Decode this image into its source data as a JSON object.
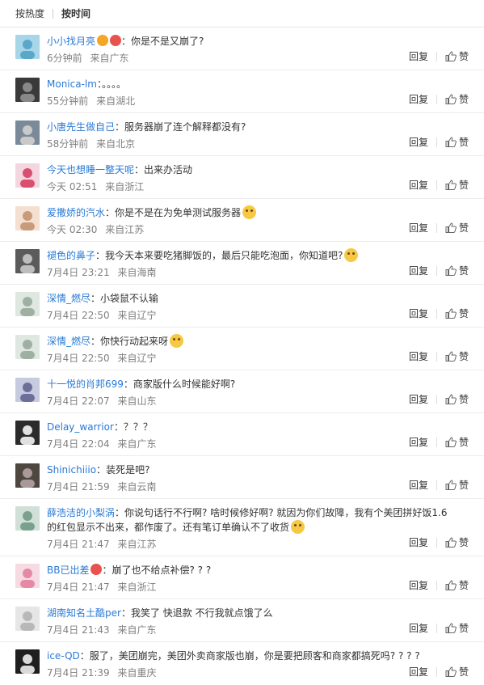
{
  "sort": {
    "hot": "按热度",
    "time": "按时间"
  },
  "actions": {
    "reply": "回复",
    "like": "赞"
  },
  "colors": {
    "link": "#2a7ad5",
    "meta": "#808080",
    "text": "#333333"
  },
  "comments": [
    {
      "user": "小小找月亮",
      "text": "你是不是又崩了?",
      "time": "6分钟前",
      "loc": "来自广东",
      "badges": [
        "vip-v-icon",
        "member-badge-icon"
      ]
    },
    {
      "user": "Monica-lm",
      "text": "。。。。",
      "time": "55分钟前",
      "loc": "来自湖北"
    },
    {
      "user": "小唐先生做自己",
      "text": "服务器崩了连个解释都没有?",
      "time": "58分钟前",
      "loc": "来自北京"
    },
    {
      "user": "今天也想睡一整天呢",
      "text": "出来办活动",
      "time": "今天 02:51",
      "loc": "来自浙江"
    },
    {
      "user": "爱撒娇的汽水",
      "text": "你是不是在为免单测试服务器",
      "time": "今天 02:30",
      "loc": "来自江苏",
      "emoji": "doge-emoji"
    },
    {
      "user": "褪色的鼻子",
      "text": "我今天本来要吃猪脚饭的，最后只能吃泡面，你知道吧?",
      "time": "7月4日 23:21",
      "loc": "来自海南",
      "emoji": "sad-emoji"
    },
    {
      "user": "深情_燃尽",
      "text": "小袋鼠不认输",
      "time": "7月4日 22:50",
      "loc": "来自辽宁"
    },
    {
      "user": "深情_燃尽",
      "text": "你快行动起来呀",
      "time": "7月4日 22:50",
      "loc": "来自辽宁",
      "emoji": "doge-emoji"
    },
    {
      "user": "十一悦的肖邦699",
      "text": "商家版什么时候能好啊?",
      "time": "7月4日 22:07",
      "loc": "来自山东"
    },
    {
      "user": "Delay_warrior",
      "text": "？？？",
      "time": "7月4日 22:04",
      "loc": "来自广东"
    },
    {
      "user": "Shinichiiio",
      "text": "装死是吧?",
      "time": "7月4日 21:59",
      "loc": "来自云南"
    },
    {
      "user": "薛浩洁的小梨涡",
      "text": "你说句话行不行啊? 啥时候修好啊? 就因为你们故障，我有个美团拼好饭1.6的红包显示不出来，都作废了。还有笔订单确认不了收货",
      "time": "7月4日 21:47",
      "loc": "来自江苏",
      "emoji": "sweat-emoji",
      "tall": true
    },
    {
      "user": "BB已出差",
      "text": "崩了也不给点补偿? ? ?",
      "time": "7月4日 21:47",
      "loc": "来自浙江",
      "badges": [
        "member-badge-icon"
      ]
    },
    {
      "user": "湖南知名土酷per",
      "text": "我笑了 快退款 不行我就点饿了么",
      "time": "7月4日 21:43",
      "loc": "来自广东"
    },
    {
      "user": "ice-QD",
      "text": "服了，美团崩完，美团外卖商家版也崩，你是要把顾客和商家都搞死吗? ? ? ?",
      "time": "7月4日 21:39",
      "loc": "来自重庆"
    }
  ]
}
